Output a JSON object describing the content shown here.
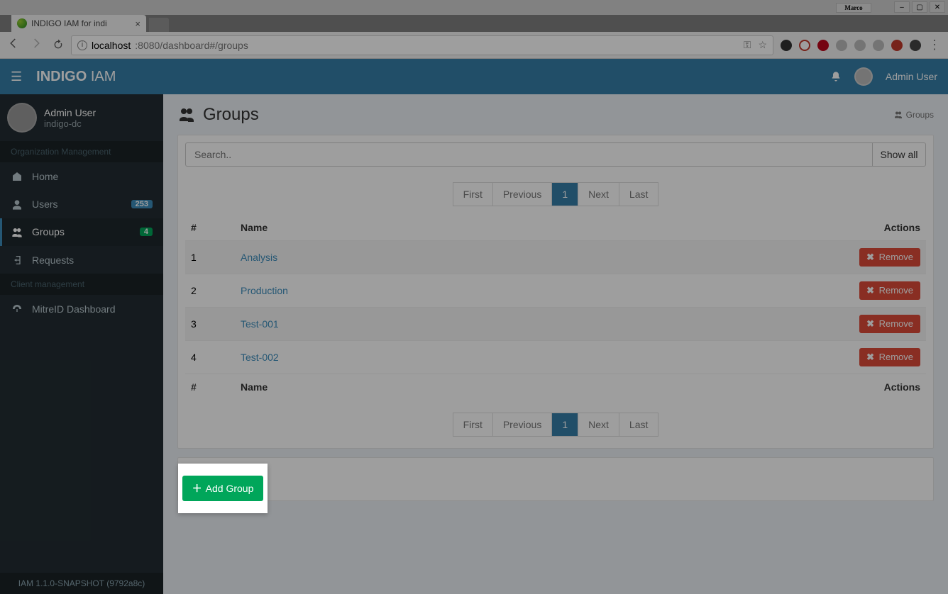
{
  "os": {
    "logo_text": "Marco"
  },
  "browser": {
    "tab_title": "INDIGO IAM for indi",
    "url_host": "localhost",
    "url_rest": ":8080/dashboard#/groups"
  },
  "navbar": {
    "brand_bold": "INDIGO",
    "brand_light": " IAM",
    "username": "Admin User"
  },
  "sidebar": {
    "user_name": "Admin User",
    "user_org": "indigo-dc",
    "section1": "Organization Management",
    "section2": "Client management",
    "items": {
      "home": {
        "label": "Home"
      },
      "users": {
        "label": "Users",
        "badge": "253"
      },
      "groups": {
        "label": "Groups",
        "badge": "4"
      },
      "requests": {
        "label": "Requests"
      },
      "mitre": {
        "label": "MitreID Dashboard"
      }
    },
    "footer": "IAM 1.1.0-SNAPSHOT (9792a8c)"
  },
  "page": {
    "title": "Groups",
    "breadcrumb": "Groups",
    "search_placeholder": "Search..",
    "show_all": "Show all",
    "pagination": {
      "first": "First",
      "prev": "Previous",
      "page": "1",
      "next": "Next",
      "last": "Last"
    },
    "columns": {
      "hash": "#",
      "name": "Name",
      "actions": "Actions"
    },
    "rows": [
      {
        "n": "1",
        "name": "Analysis"
      },
      {
        "n": "2",
        "name": "Production"
      },
      {
        "n": "3",
        "name": "Test-001"
      },
      {
        "n": "4",
        "name": "Test-002"
      }
    ],
    "remove_label": "Remove",
    "add_group": "Add Group"
  }
}
